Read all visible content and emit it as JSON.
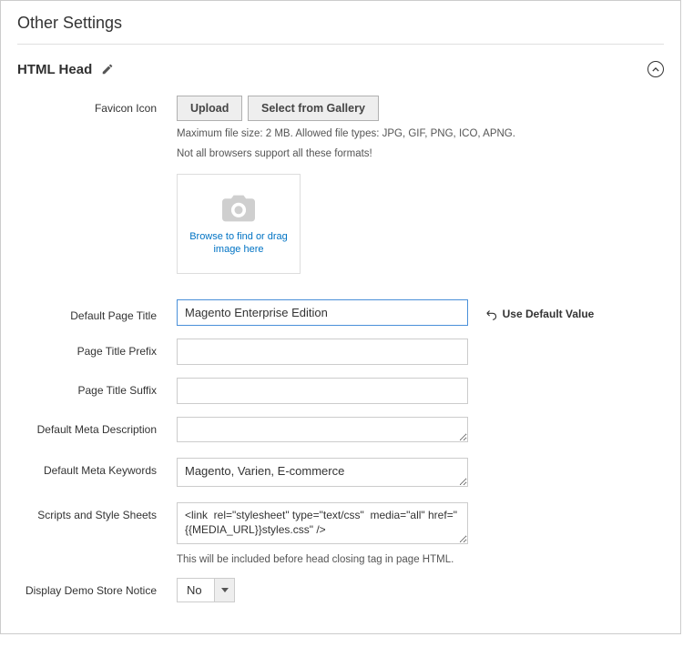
{
  "page": {
    "title": "Other Settings"
  },
  "section": {
    "title": "HTML Head"
  },
  "favicon": {
    "label": "Favicon Icon",
    "uploadBtn": "Upload",
    "galleryBtn": "Select from Gallery",
    "hint1": "Maximum file size: 2 MB. Allowed file types: JPG, GIF, PNG, ICO, APNG.",
    "hint2": "Not all browsers support all these formats!",
    "browseText": "Browse to find or drag image here"
  },
  "defaultTitle": {
    "label": "Default Page Title",
    "value": "Magento Enterprise Edition",
    "defaultAction": "Use Default Value"
  },
  "titlePrefix": {
    "label": "Page Title Prefix",
    "value": ""
  },
  "titleSuffix": {
    "label": "Page Title Suffix",
    "value": ""
  },
  "metaDesc": {
    "label": "Default Meta Description",
    "value": ""
  },
  "metaKeywords": {
    "label": "Default Meta Keywords",
    "value": "Magento, Varien, E-commerce"
  },
  "scripts": {
    "label": "Scripts and Style Sheets",
    "value": "<link  rel=\"stylesheet\" type=\"text/css\"  media=\"all\" href=\"{{MEDIA_URL}}styles.css\" />",
    "note": "This will be included before head closing tag in page HTML."
  },
  "demoNotice": {
    "label": "Display Demo Store Notice",
    "value": "No"
  }
}
